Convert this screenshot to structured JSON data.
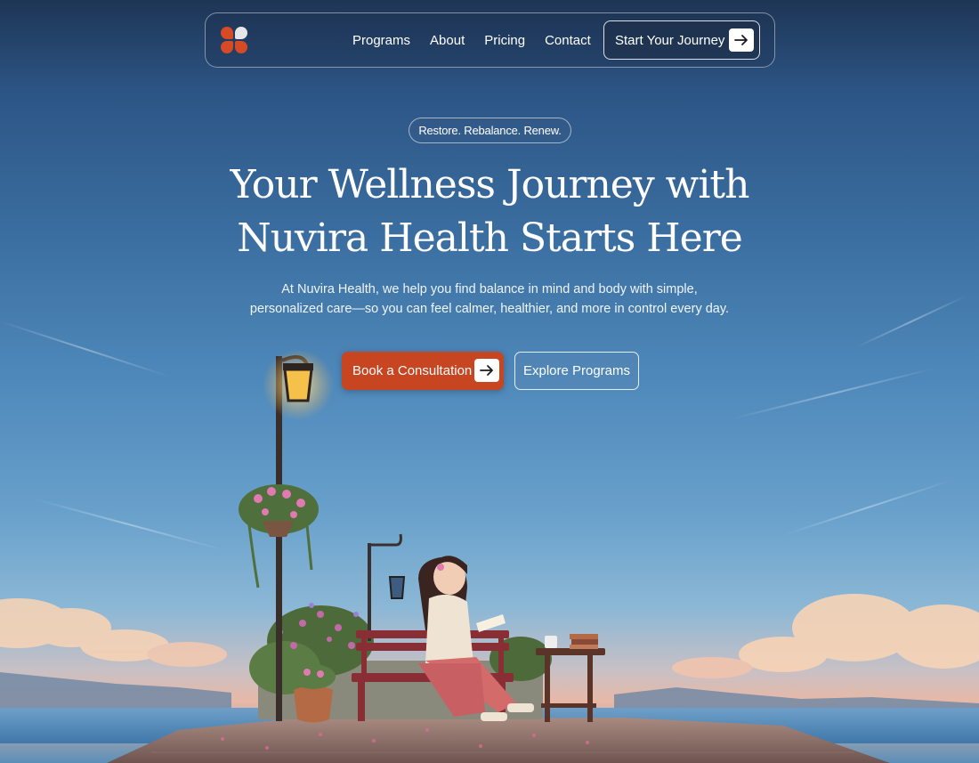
{
  "nav": {
    "links": [
      "Programs",
      "About",
      "Pricing",
      "Contact"
    ],
    "cta_label": "Start Your Journey"
  },
  "hero": {
    "tagline": "Restore. Rebalance. Renew.",
    "headline_line1": "Your Wellness Journey with",
    "headline_line2": "Nuvira Health Starts Here",
    "subtext_line1": "At Nuvira Health, we help you find balance in mind and body with simple,",
    "subtext_line2": "personalized care—so you can feel calmer, healthier, and more in control every day.",
    "primary_button": "Book a Consultation",
    "secondary_button": "Explore Programs"
  },
  "icons": {
    "logo": "clover-logo-icon",
    "arrow": "arrow-right-icon"
  },
  "colors": {
    "accent": "#c84522",
    "logo_orange": "#d64a25",
    "sky_top": "#1e3555"
  }
}
